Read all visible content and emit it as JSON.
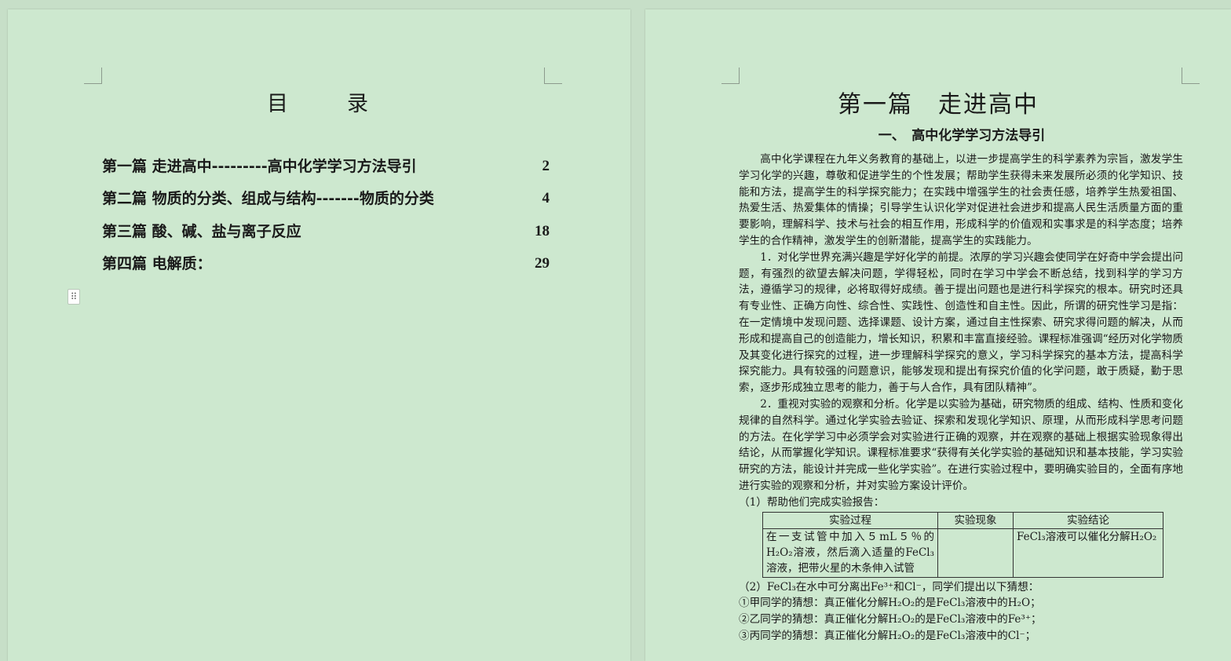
{
  "toc": {
    "title": "目　录",
    "entries": [
      {
        "title": "第一篇  走进高中---------高中化学学习方法导引",
        "page": "2"
      },
      {
        "title": "第二篇  物质的分类、组成与结构-------物质的分类",
        "page": "4"
      },
      {
        "title": "第三篇  酸、碱、盐与离子反应",
        "page": "18"
      },
      {
        "title": "第四篇  电解质：",
        "page": "29"
      }
    ]
  },
  "chapter": {
    "title": "第一篇　走进高中",
    "section_title": "一、　高中化学学习方法导引",
    "paragraphs": [
      "高中化学课程在九年义务教育的基础上，以进一步提高学生的科学素养为宗旨，激发学生学习化学的兴趣，尊敬和促进学生的个性发展；帮助学生获得未来发展所必须的化学知识、技能和方法，提高学生的科学探究能力；在实践中增强学生的社会责任感，培养学生热爱祖国、热爱生活、热爱集体的情操；引导学生认识化学对促进社会进步和提高人民生活质量方面的重要影响，理解科学、技术与社会的相互作用，形成科学的价值观和实事求是的科学态度；培养学生的合作精神，激发学生的创新潜能，提高学生的实践能力。",
      "1．对化学世界充满兴趣是学好化学的前提。浓厚的学习兴趣会使同学在好奇中学会提出问题，有强烈的欲望去解决问题，学得轻松，同时在学习中学会不断总结，找到科学的学习方法，遵循学习的规律，必将取得好成绩。善于提出问题也是进行科学探究的根本。研究时还具有专业性、正确方向性、综合性、实践性、创造性和自主性。因此，所谓的研究性学习是指：在一定情境中发现问题、选择课题、设计方案，通过自主性探索、研究求得问题的解决，从而形成和提高自己的创造能力，增长知识，积累和丰富直接经验。课程标准强调“经历对化学物质及其变化进行探究的过程，进一步理解科学探究的意义，学习科学探究的基本方法，提高科学探究能力。具有较强的问题意识，能够发现和提出有探究价值的化学问题，敢于质疑，勤于思索，逐步形成独立思考的能力，善于与人合作，具有团队精神”。",
      "2．重视对实验的观察和分析。化学是以实验为基础，研究物质的组成、结构、性质和变化规律的自然科学。通过化学实验去验证、探索和发现化学知识、原理，从而形成科学思考问题的方法。在化学学习中必须学会对实验进行正确的观察，并在观察的基础上根据实验现象得出结论，从而掌握化学知识。课程标准要求“获得有关化学实验的基础知识和基本技能，学习实验研究的方法，能设计并完成一些化学实验”。在进行实验过程中，要明确实验目的，全面有序地进行实验的观察和分析，并对实验方案设计评价。"
    ],
    "question1": "（1）帮助他们完成实验报告：",
    "table": {
      "headers": [
        "实验过程",
        "实验现象",
        "实验结论"
      ],
      "row": [
        "在一支试管中加入５mL５％的H₂O₂溶液，然后滴入适量的FeCl₃溶液，把带火星的木条伸入试管",
        "",
        "FeCl₃溶液可以催化分解H₂O₂"
      ]
    },
    "question2": "（2）FeCl₃在水中可分离出Fe³⁺和Cl⁻，同学们提出以下猜想：",
    "guesses": [
      "①甲同学的猜想：真正催化分解H₂O₂的是FeCl₃溶液中的H₂O；",
      "②乙同学的猜想：真正催化分解H₂O₂的是FeCl₃溶液中的Fe³⁺；",
      "③丙同学的猜想：真正催化分解H₂O₂的是FeCl₃溶液中的Cl⁻；"
    ]
  }
}
